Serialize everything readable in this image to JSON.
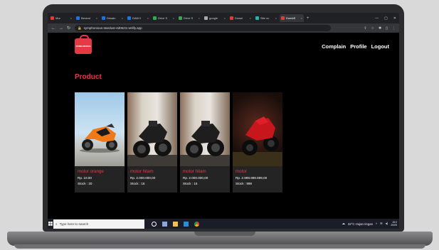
{
  "browser": {
    "tabs": [
      {
        "label": "Mor",
        "color": "#e53935"
      },
      {
        "label": "Berand",
        "color": "#1a73e8"
      },
      {
        "label": "Desain",
        "color": "#1a73e8"
      },
      {
        "label": "DAW Il",
        "color": "#1a73e8"
      },
      {
        "label": "Drive S",
        "color": "#34a853"
      },
      {
        "label": "Drive S",
        "color": "#34a853"
      },
      {
        "label": "google",
        "color": "#aaaaaa"
      },
      {
        "label": "Downl",
        "color": "#e53935"
      },
      {
        "label": "Site ov",
        "color": "#2bb3a3"
      },
      {
        "label": "DumbS",
        "color": "#e53935"
      }
    ],
    "active_tab": 9,
    "url": "symphonious-stardust-4d0623.netlify.app"
  },
  "site": {
    "logo_text": "DUMB MERCH",
    "nav": [
      "Complain",
      "Profile",
      "Logout"
    ],
    "section_title": "Product",
    "products": [
      {
        "name": "motor orange",
        "price": "Rp. 10.00",
        "stock": "Stock : 20"
      },
      {
        "name": "motor hitam",
        "price": "Rp. 2.000.000,00",
        "stock": "Stock : 15"
      },
      {
        "name": "motor hitam",
        "price": "Rp. 2.000.000,00",
        "stock": "Stock : 15"
      },
      {
        "name": "motor",
        "price": "Rp. 2.999.999.999,00",
        "stock": "Stock : 999"
      }
    ]
  },
  "taskbar": {
    "search_placeholder": "Type here to search",
    "weather": "32°C  Hujan ringan",
    "time": "15:0",
    "date": "20/09"
  }
}
